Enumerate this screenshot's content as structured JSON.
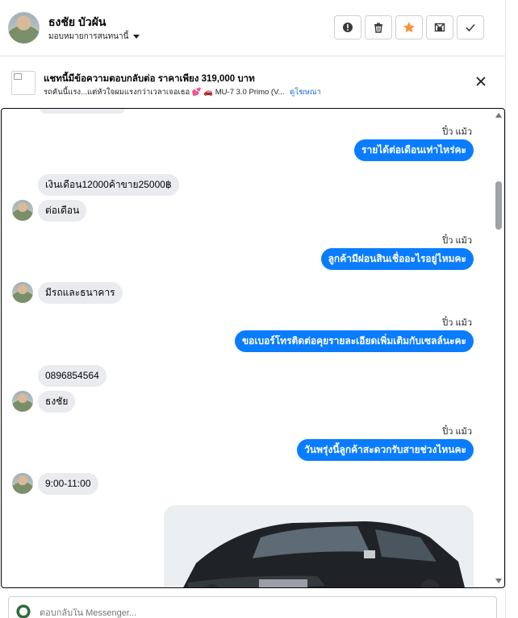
{
  "contact": {
    "name": "ธงชัย บัวผัน",
    "assign_label": "มอบหมายการสนทนานี้"
  },
  "toolbar": {
    "buttons": [
      {
        "name": "spam-button",
        "icon": "alert-circle-icon"
      },
      {
        "name": "delete-button",
        "icon": "trash-icon"
      },
      {
        "name": "star-button",
        "icon": "star-icon",
        "color": "#f7923b"
      },
      {
        "name": "mark-unread-button",
        "icon": "envelope-x-icon"
      },
      {
        "name": "done-button",
        "icon": "check-icon"
      }
    ]
  },
  "ad": {
    "title": "แชทนี้มีข้อความตอบกลับต่อ ราคาเพียง 319,000 บาท",
    "subtitle": "รถคันนี้แรง...แต่หัวใจผมแรงกว่าเวลาเจอเธอ 💕 🚗 MU-7 3.0 Primo (V...",
    "link": "ดูโฆษณา"
  },
  "messages": {
    "m1": {
      "sender": "ปิ๋ว แม้ว",
      "text": "รายได้ต่อเดือนเท่าไหร่คะ"
    },
    "m2": {
      "text": "เงินเดือน12000ค้าขาย25000฿"
    },
    "m3": {
      "text": "ต่อเดือน"
    },
    "m4": {
      "sender": "ปิ๋ว แม้ว",
      "text": "ลูกค้ามีผ่อนสินเชื่ออะไรอยู่ไหมคะ"
    },
    "m5": {
      "text": "มีรถและธนาคาร"
    },
    "m6": {
      "sender": "ปิ๋ว แม้ว",
      "text": "ขอเบอร์โทรติดต่อคุยรายละเอียดเพิ่มเติมกับเซลล์นะคะ"
    },
    "m7": {
      "text": "0896854564"
    },
    "m8": {
      "text": "ธงชัย"
    },
    "m9": {
      "sender": "ปิ๋ว แม้ว",
      "text": "วันพรุ่งนี้ลูกค้าสะดวกรับสายช่วงไหนคะ"
    },
    "m10": {
      "text": "9:00-11:00"
    }
  },
  "colors": {
    "outgoing_bubble": "#0a7cff",
    "incoming_bubble": "#e9ebee",
    "link": "#216fdb"
  },
  "reply": {
    "placeholder": "ตอบกลับใน Messenger..."
  }
}
